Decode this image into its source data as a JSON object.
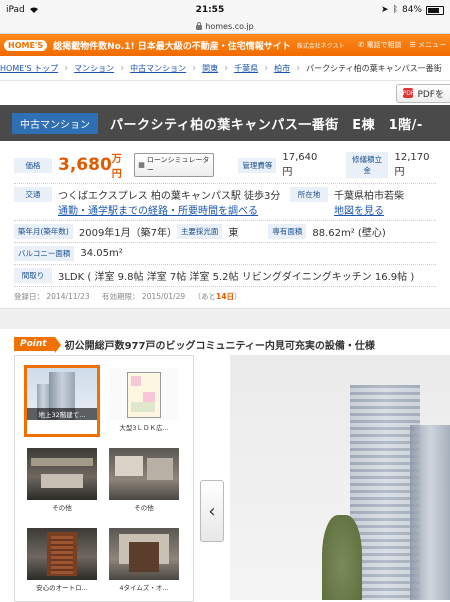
{
  "status": {
    "device": "iPad",
    "time": "21:55",
    "battery": "84%"
  },
  "url": "homes.co.jp",
  "header": {
    "logo": "HOME'S",
    "tagline": "総掲載物件数No.1! 日本最大級の不動産・住宅情報サイト",
    "company": "株式会社ネクスト",
    "phone": "電話で相談",
    "menu": "メニュー"
  },
  "breadcrumb": [
    "HOME'S トップ",
    "マンション",
    "中古マンション",
    "関東",
    "千葉県",
    "柏市",
    "パークシティ柏の葉キャンパス一番街"
  ],
  "pdf_label": "PDFを",
  "title": {
    "category": "中古マンション",
    "name": "パークシティ柏の葉キャンパス一番街　E棟　1階/-"
  },
  "details": {
    "price_label": "価格",
    "price_value": "3,680",
    "price_unit": "万円",
    "loan_button": "ローンシミュレーター",
    "mgmt_label": "管理費等",
    "mgmt_value": "17,640円",
    "repair_label": "修繕積立金",
    "repair_value": "12,170円",
    "access_label": "交通",
    "access_value": "つくばエクスプレス 柏の葉キャンパス駅 徒歩3分",
    "access_link": "通勤・通学駅までの経路・所要時間を調べる",
    "address_label": "所在地",
    "address_value": "千葉県柏市若柴",
    "map_link": "地図を見る",
    "built_label": "築年月(築年数)",
    "built_value": "2009年1月（築7年）",
    "direction_label": "主要採光面",
    "direction_value": "東",
    "area_label": "専有面積",
    "area_value": "88.62m² (壁心)",
    "balcony_label": "バルコニー面積",
    "balcony_value": "34.05m²",
    "layout_label": "間取り",
    "layout_value": "3LDK ( 洋室 9.8帖 洋室 7帖 洋室 5.2帖 リビングダイニングキッチン 16.9帖 )"
  },
  "dates": {
    "registered": "登録日： 2014/11/23",
    "valid_label": "有効期限： 2015/01/29",
    "remain_prefix": "（あと",
    "remain_days": "14日",
    "remain_suffix": "）"
  },
  "point": {
    "tag": "Point",
    "text": "初公開総戸数977戸のビッグコミュニティー内見可充実の設備・仕様"
  },
  "thumbnails": [
    {
      "caption": "地上32階建て..."
    },
    {
      "caption": "大型3ＬＤＫ広..."
    },
    {
      "caption": "その他"
    },
    {
      "caption": "その他"
    },
    {
      "caption": "安心のオートロ..."
    },
    {
      "caption": "4タイムズ・オ..."
    }
  ],
  "nav": {
    "prev": "‹"
  }
}
